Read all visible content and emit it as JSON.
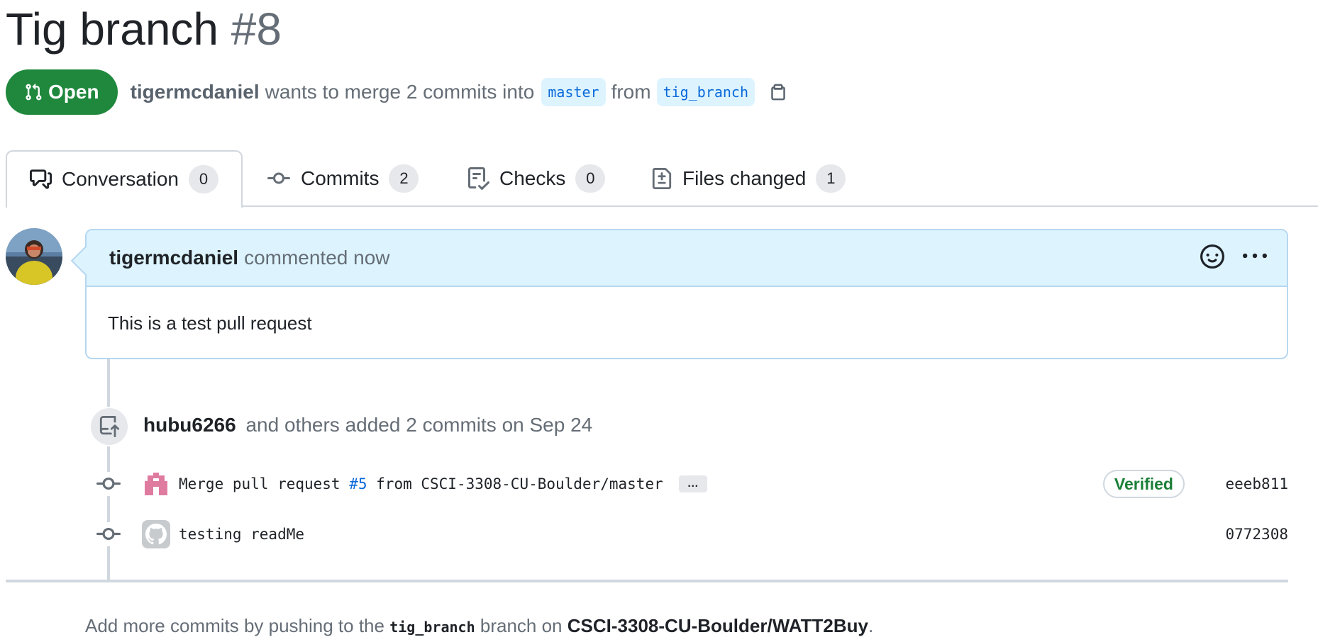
{
  "pr": {
    "title": "Tig branch",
    "number": "#8",
    "state": "Open",
    "author": "tigermcdaniel",
    "merge_text": "wants to merge 2 commits into",
    "base_branch": "master",
    "from_text": "from",
    "head_branch": "tig_branch"
  },
  "tabs": [
    {
      "label": "Conversation",
      "count": "0",
      "icon": "comment-discussion-icon"
    },
    {
      "label": "Commits",
      "count": "2",
      "icon": "git-commit-icon"
    },
    {
      "label": "Checks",
      "count": "0",
      "icon": "checklist-icon"
    },
    {
      "label": "Files changed",
      "count": "1",
      "icon": "file-diff-icon"
    }
  ],
  "comment": {
    "author": "tigermcdaniel",
    "action": "commented now",
    "body": "This is a test pull request"
  },
  "event": {
    "author": "hubu6266",
    "text": "and others added 2 commits on Sep 24"
  },
  "commits": [
    {
      "message_prefix": "Merge pull request ",
      "issue_ref": "#5",
      "message_suffix": " from CSCI-3308-CU-Boulder/master",
      "ellipsis": "…",
      "badge": "Verified",
      "sha": "eeeb811"
    },
    {
      "message": "testing readMe",
      "sha": "0772308"
    }
  ],
  "footer": {
    "prefix": "Add more commits by pushing to the",
    "branch": "tig_branch",
    "middle": "branch on",
    "repo": "CSCI-3308-CU-Boulder/WATT2Buy",
    "suffix": "."
  },
  "colors": {
    "open_green": "#1f883d",
    "link_blue": "#0969da",
    "verified_green": "#1a7f37"
  }
}
